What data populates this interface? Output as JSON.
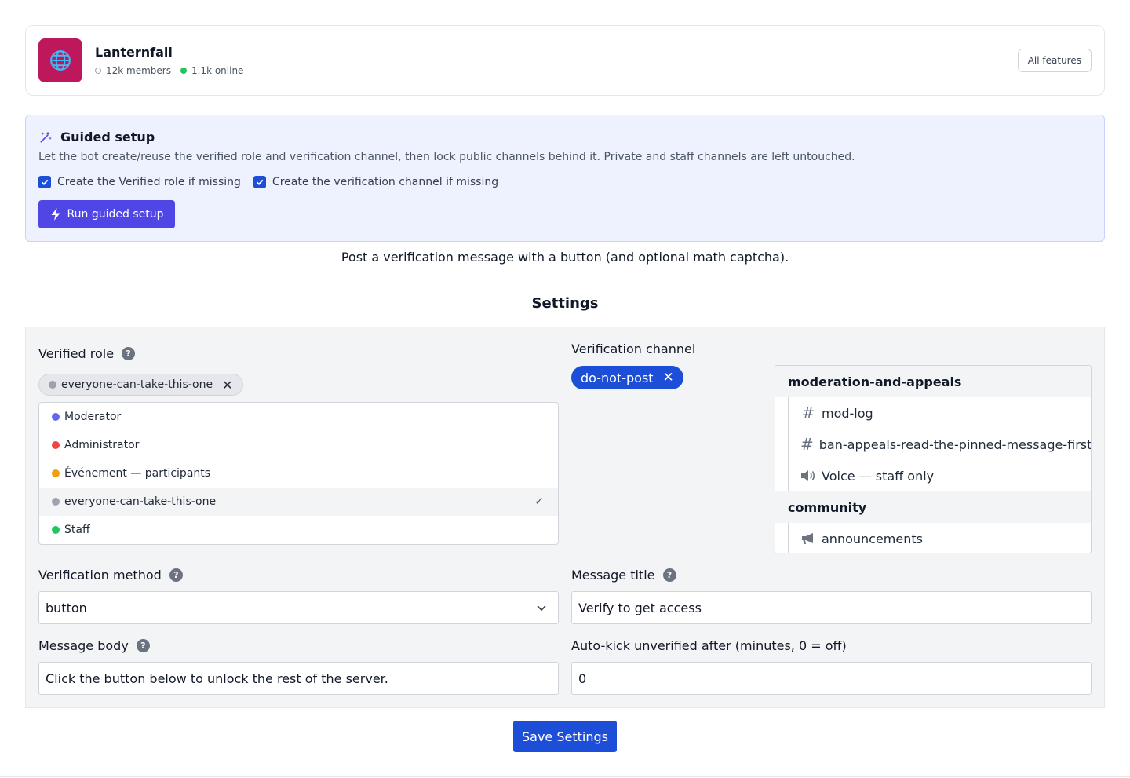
{
  "server": {
    "name": "Lanternfall",
    "members": "12k members",
    "online": "1.1k online",
    "icon": "globe-icon",
    "icon_bg": "#be185d",
    "features_button": "All features"
  },
  "guided_setup": {
    "title": "Guided setup",
    "description": "Let the bot create/reuse the verified role and verification channel, then lock public channels behind it. Private and staff channels are left untouched.",
    "options": [
      {
        "label": "Create the Verified role if missing",
        "checked": true
      },
      {
        "label": "Create the verification channel if missing",
        "checked": true
      }
    ],
    "run_button": "Run guided setup",
    "accent": "#4f46e5"
  },
  "intro_text": "Post a verification message with a button (and optional math captcha).",
  "settings_heading": "Settings",
  "verified_role": {
    "label": "Verified role",
    "help": "?",
    "selected_chip": "everyone-can-take-this-one",
    "remove_glyph": "✕",
    "options": [
      {
        "name": "Moderator",
        "color": "#6366f1",
        "selected": false
      },
      {
        "name": "Administrator",
        "color": "#ef4444",
        "selected": false
      },
      {
        "name": "Événement — participants",
        "color": "#f59e0b",
        "selected": false
      },
      {
        "name": "everyone-can-take-this-one",
        "color": "#9ca3af",
        "selected": true
      },
      {
        "name": "Staff",
        "color": "#22c55e",
        "selected": false
      }
    ],
    "check_glyph": "✓"
  },
  "verification_channel": {
    "label": "Verification channel",
    "selected_chip": "do-not-post",
    "remove_glyph": "✕",
    "categories": [
      {
        "name": "moderation-and-appeals",
        "channels": [
          {
            "name": "mod-log",
            "icon": "hash-icon"
          },
          {
            "name": "ban-appeals-read-the-pinned-message-first",
            "icon": "hash-icon"
          },
          {
            "name": "Voice — staff only",
            "icon": "speaker-icon"
          }
        ]
      },
      {
        "name": "community",
        "channels": [
          {
            "name": "announcements",
            "icon": "megaphone-icon"
          }
        ]
      }
    ]
  },
  "verification_method": {
    "label": "Verification method",
    "help": "?",
    "value": "button"
  },
  "message_title": {
    "label": "Message title",
    "help": "?",
    "value": "Verify to get access"
  },
  "message_body": {
    "label": "Message body",
    "help": "?",
    "value": "Click the button below to unlock the rest of the server."
  },
  "auto_kick": {
    "label": "Auto-kick unverified after (minutes, 0 = off)",
    "value": "0"
  },
  "save_button": "Save Settings",
  "primary_color": "#1d4ed8"
}
